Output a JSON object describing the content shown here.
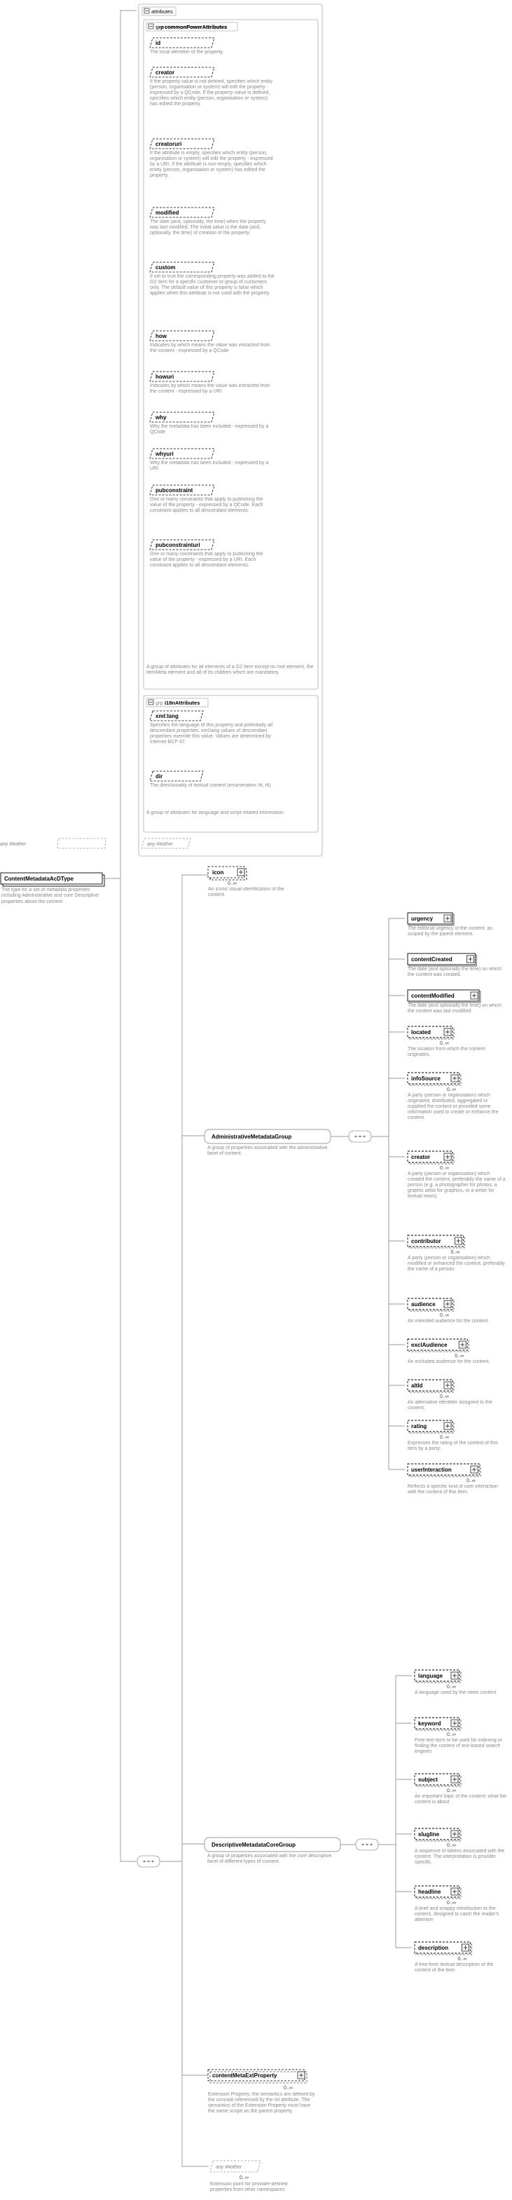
{
  "root": {
    "name": "ContentMetadataAcDType",
    "label": "ContentMetadataAcDType",
    "desc": "The type for a set of metadata properties including Administrative and core Descriptive properties about the content"
  },
  "attributesHeader": "attributes",
  "grpCommon": {
    "label": "grp commonPowerAttributes",
    "items": [
      {
        "name": "id",
        "desc": "The local identifier of the property."
      },
      {
        "name": "creator",
        "desc": "If the property value is not defined, specifies which entity (person, organisation or system) will edit the property - expressed by a QCode. If the property value is defined, specifies which entity (person, organisation or system) has edited the property."
      },
      {
        "name": "creatoruri",
        "desc": "If the attribute is empty, specifies which entity (person, organisation or system) will edit the property - expressed by a URI. If the attribute is non-empty, specifies which entity (person, organisation or system) has edited the property."
      },
      {
        "name": "modified",
        "desc": "The date (and, optionally, the time) when the property was last modified. The initial value is the date (and, optionally, the time) of creation of the property."
      },
      {
        "name": "custom",
        "desc": "If set to true the corresponding property was added to the G2 Item for a specific customer or group of customers only. The default value of this property is false which applies when this attribute is not used with the property."
      },
      {
        "name": "how",
        "desc": "Indicates by which means the value was extracted from the content - expressed by a QCode"
      },
      {
        "name": "howuri",
        "desc": "Indicates by which means the value was extracted from the content - expressed by a URI"
      },
      {
        "name": "why",
        "desc": "Why the metadata has been included - expressed by a QCode"
      },
      {
        "name": "whyuri",
        "desc": "Why the metadata has been included - expressed by a URI"
      },
      {
        "name": "pubconstraint",
        "desc": "One or many constraints that apply to publishing the value of the property - expressed by a QCode. Each constraint applies to all descendant elements."
      },
      {
        "name": "pubconstrainturi",
        "desc": "One or many constraints that apply to publishing the value of the property - expressed by a URI. Each constraint applies to all descendant elements."
      }
    ],
    "footer": "A group of attributes for all elements of a G2 Item except its root element, the itemMeta element and all of its children which are mandatory."
  },
  "grpI18n": {
    "label": "grp i18nAttributes",
    "items": [
      {
        "name": "xml:lang",
        "desc": "Specifies the language of this property and potentially all descendant properties. xml:lang values of descendant properties override this value. Values are determined by Internet BCP 47."
      },
      {
        "name": "dir",
        "desc": "The directionality of textual content (enumeration: ltr, rtl)"
      }
    ],
    "footer": "A group of attributes for language and script related information"
  },
  "anyOther": "any ##other",
  "icon": {
    "name": "icon",
    "card": "0..∞",
    "desc": "An iconic visual identification of the content."
  },
  "admin": {
    "label": "AdministrativeMetadataGroup",
    "desc": "A group of properties associated with the administrative facet of content.",
    "items": [
      {
        "name": "urgency",
        "desc": "The editorial urgency of the content, as scoped by the parent element."
      },
      {
        "name": "contentCreated",
        "desc": "The date (and optionally the time) on which the content was created."
      },
      {
        "name": "contentModified",
        "desc": "The date (and optionally the time) on which the content was last modified."
      },
      {
        "name": "located",
        "card": "0..∞",
        "desc": "The location from which the content originates."
      },
      {
        "name": "infoSource",
        "card": "0..∞",
        "desc": "A party (person or organisation) which originated, distributed, aggregated or supplied the content or provided some information used to create or enhance the content."
      },
      {
        "name": "creator",
        "card": "0..∞",
        "desc": "A party (person or organisation) which created the content, preferably the name of a person (e.g. a photographer for photos, a graphic artist for graphics, or a writer for textual news)."
      },
      {
        "name": "contributor",
        "card": "0..∞",
        "desc": "A party (person or organisation) which modified or enhanced the content, preferably the name of a person."
      },
      {
        "name": "audience",
        "card": "0..∞",
        "desc": "An intended audience for the content."
      },
      {
        "name": "exclAudience",
        "card": "0..∞",
        "desc": "An excluded audience for the content."
      },
      {
        "name": "altId",
        "card": "0..∞",
        "desc": "An alternative identifier assigned to the content."
      },
      {
        "name": "rating",
        "card": "0..∞",
        "desc": "Expresses the rating of the content of this item by a party."
      },
      {
        "name": "userInteraction",
        "card": "0..∞",
        "desc": "Reflects a specific kind of user interaction with the content of this item."
      }
    ]
  },
  "descriptive": {
    "label": "DescriptiveMetadataCoreGroup",
    "desc": "A group of properties associated with the core descriptive facet of different types of content.",
    "items": [
      {
        "name": "language",
        "card": "0..∞",
        "desc": "A language used by the news content"
      },
      {
        "name": "keyword",
        "card": "0..∞",
        "desc": "Free-text term to be used for indexing or finding the content of text-based search engines"
      },
      {
        "name": "subject",
        "card": "0..∞",
        "desc": "An important topic of the content; what the content is about"
      },
      {
        "name": "slugline",
        "card": "0..∞",
        "desc": "A sequence of tokens associated with the content. The interpretation is provider specific."
      },
      {
        "name": "headline",
        "card": "0..∞",
        "desc": "A brief and snappy introduction to the content, designed to catch the reader's attention"
      },
      {
        "name": "description",
        "card": "0..∞",
        "desc": "A free-form textual description of the content of the item"
      }
    ]
  },
  "ext": {
    "name": "contentMetaExtProperty",
    "card": "0..∞",
    "desc": "Extension Property; the semantics are defined by the concept referenced by the rel attribute. The semantics of the Extension Property must have the same scope as the parent property."
  },
  "anyOtherBottom": {
    "label": "any ##other",
    "card": "0..∞",
    "desc": "Extension point for provider-defined properties from other namespaces"
  }
}
